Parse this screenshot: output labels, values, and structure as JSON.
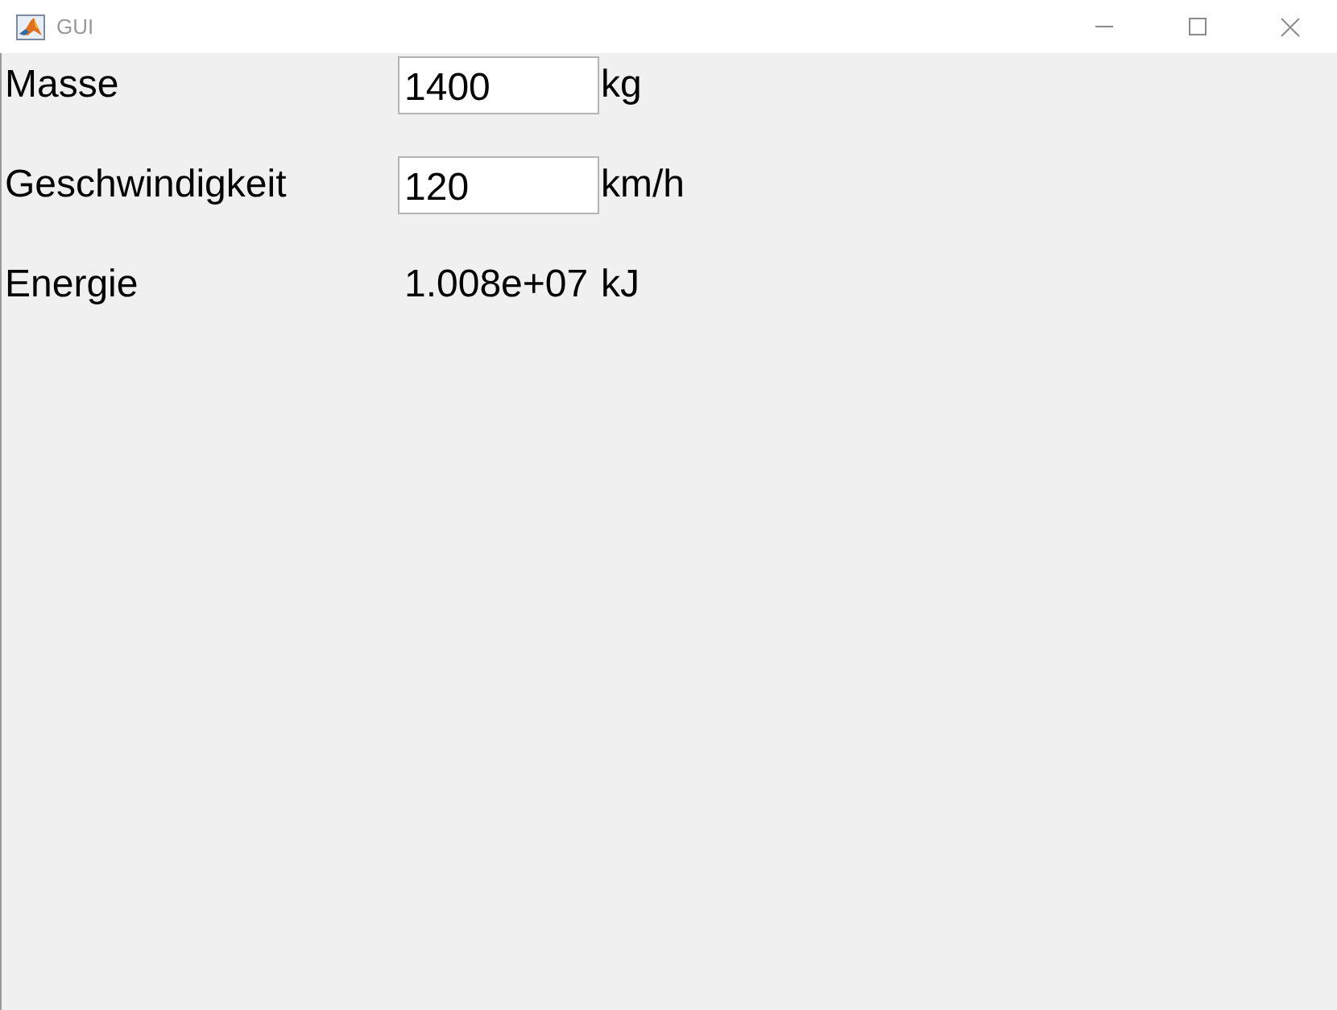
{
  "window": {
    "title": "GUI"
  },
  "form": {
    "rows": [
      {
        "kind": "input",
        "label": "Masse",
        "value": "1400",
        "unit": "kg"
      },
      {
        "kind": "input",
        "label": "Geschwindigkeit",
        "value": "120",
        "unit": "km/h"
      },
      {
        "kind": "output",
        "label": "Energie",
        "value": "1.008e+07",
        "unit": "kJ"
      }
    ]
  }
}
